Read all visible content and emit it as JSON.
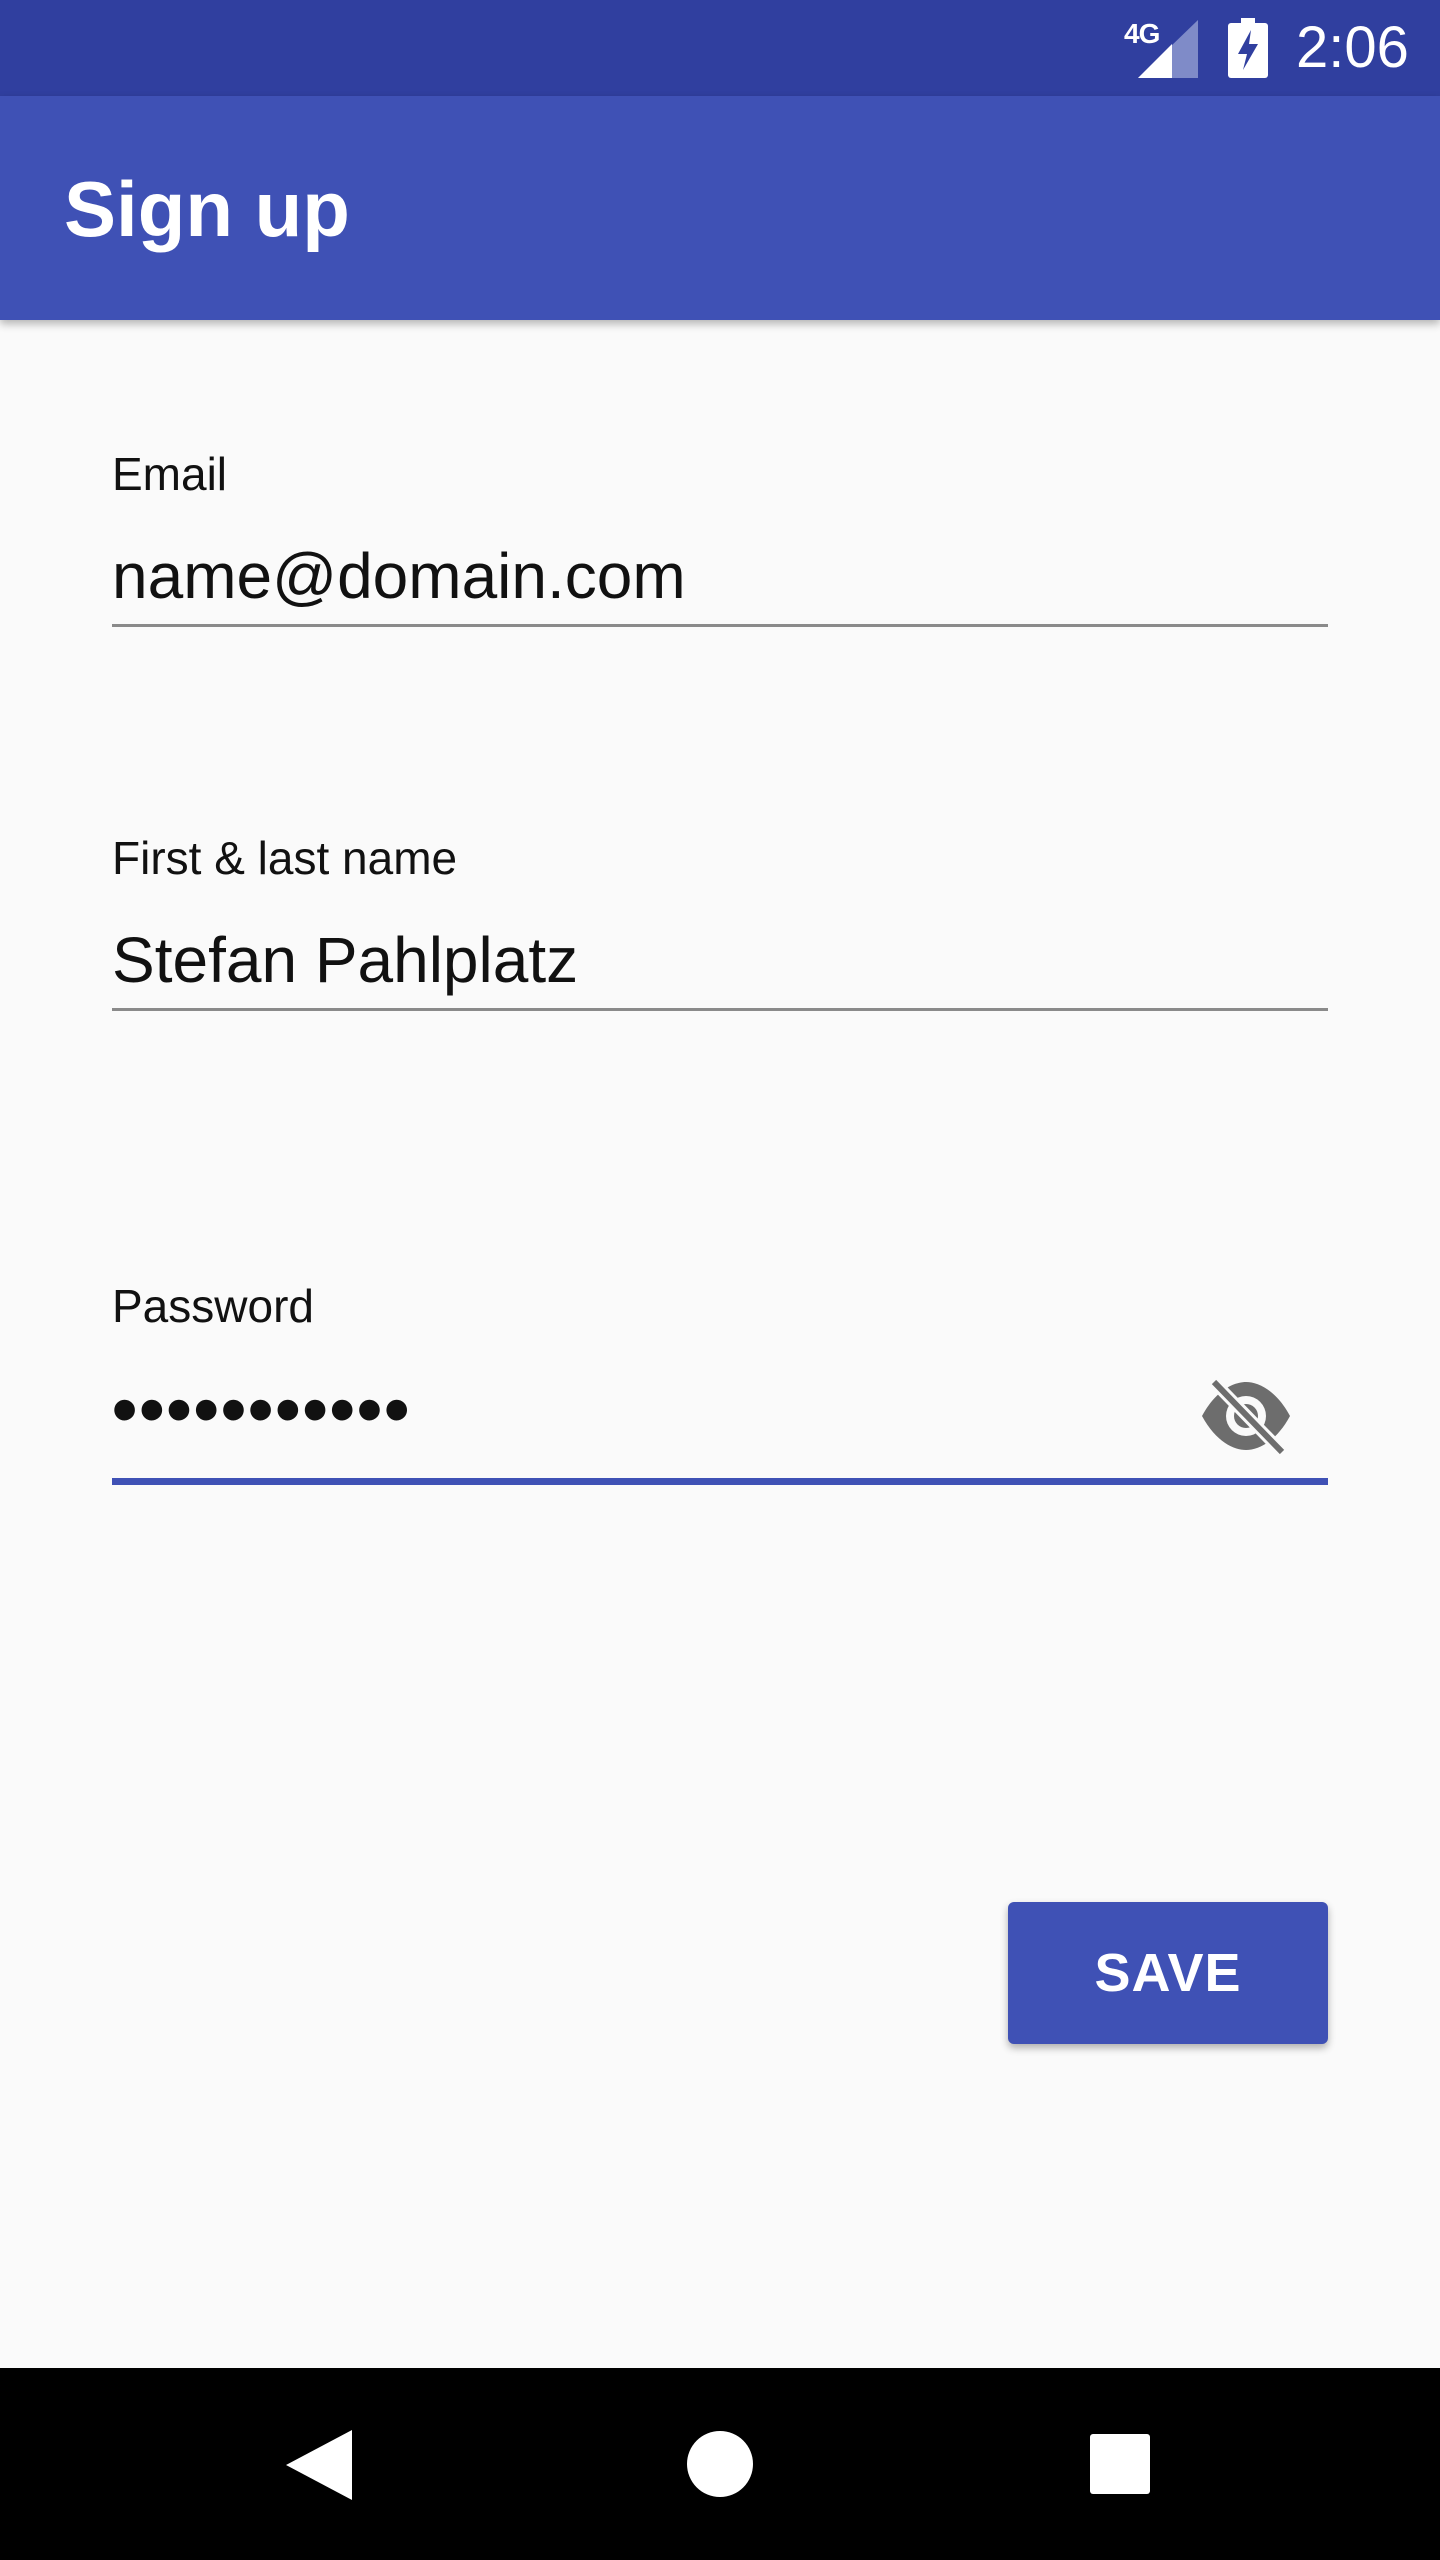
{
  "status_bar": {
    "network": "4G",
    "time": "2:06"
  },
  "app_bar": {
    "title": "Sign up"
  },
  "form": {
    "email": {
      "label": "Email",
      "value": "name@domain.com"
    },
    "name": {
      "label": "First & last name",
      "value": "Stefan Pahlplatz"
    },
    "password": {
      "label": "Password",
      "masked_value": "•••••••••••",
      "visibility_icon": "visibility-off-icon"
    }
  },
  "actions": {
    "save_label": "SAVE"
  },
  "colors": {
    "primary": "#3f51b5",
    "primary_dark": "#303f9f",
    "background": "#fafafa"
  },
  "nav_bar": {
    "icons": [
      "back-icon",
      "home-icon",
      "recents-icon"
    ]
  }
}
